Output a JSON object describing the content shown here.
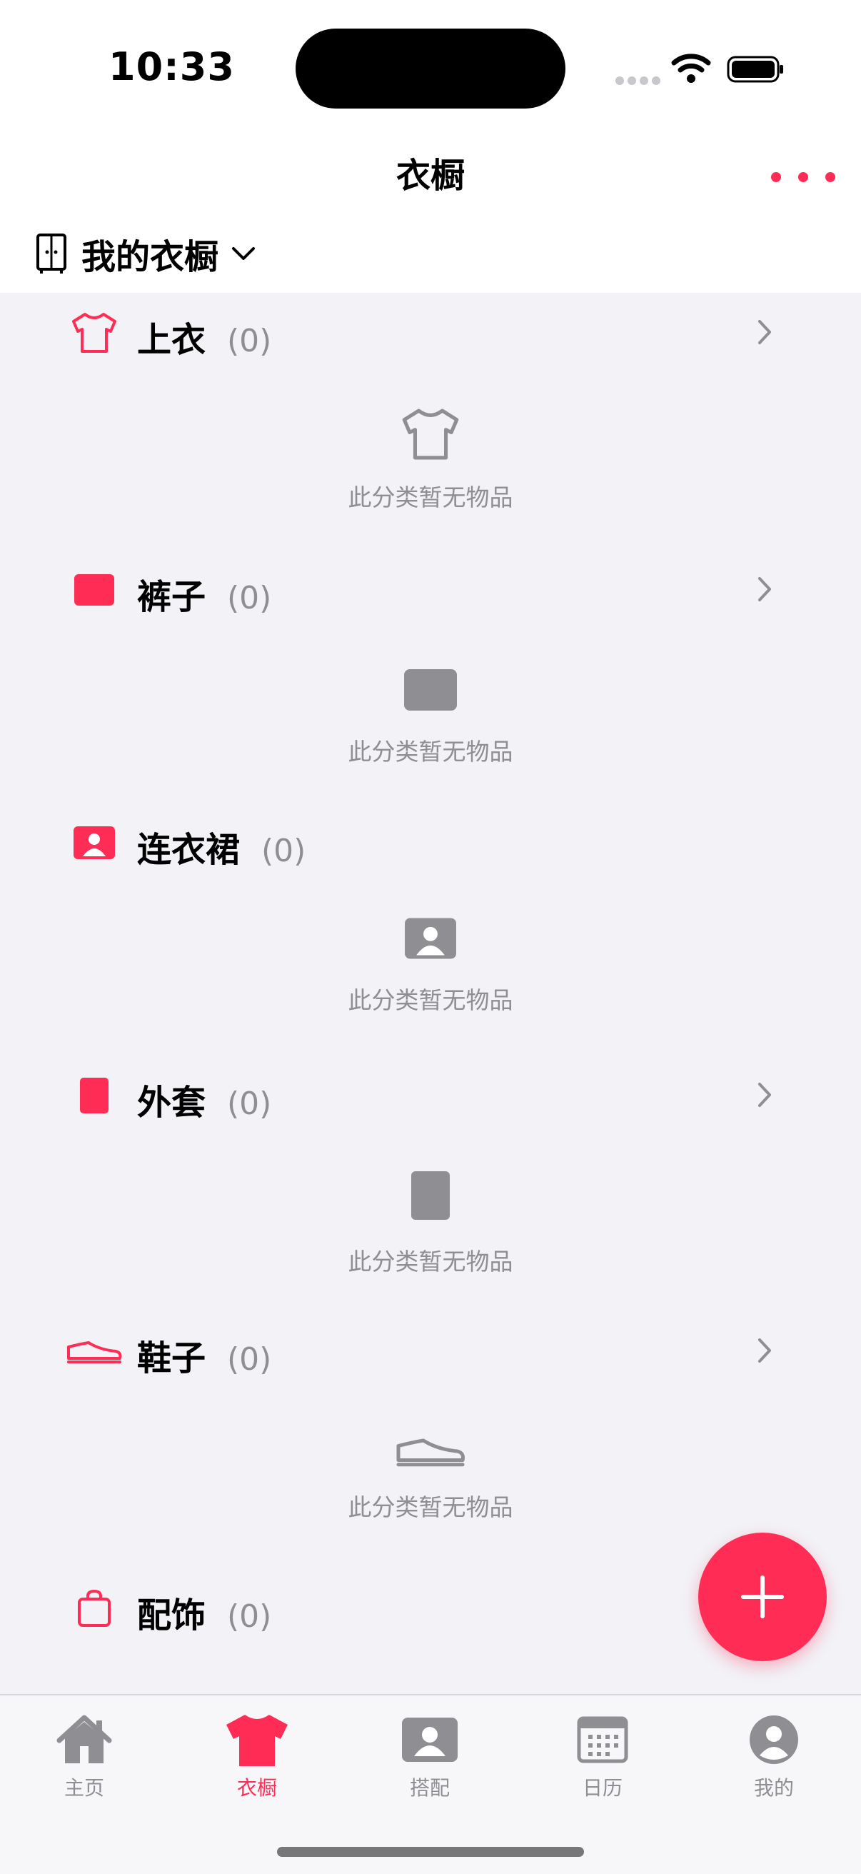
{
  "status": {
    "time": "10:33"
  },
  "nav": {
    "title": "衣橱"
  },
  "wardrobe": {
    "label": "我的衣橱"
  },
  "empty_text": "此分类暂无物品",
  "categories": [
    {
      "name": "上衣",
      "count": "(0)",
      "icon": "tshirt-icon"
    },
    {
      "name": "裤子",
      "count": "(0)",
      "icon": "pants-icon"
    },
    {
      "name": "连衣裙",
      "count": "(0)",
      "icon": "dress-icon"
    },
    {
      "name": "外套",
      "count": "(0)",
      "icon": "coat-icon"
    },
    {
      "name": "鞋子",
      "count": "(0)",
      "icon": "shoe-icon"
    },
    {
      "name": "配饰",
      "count": "(0)",
      "icon": "bag-icon"
    }
  ],
  "tabs": [
    {
      "label": "主页",
      "icon": "home-icon",
      "active": false
    },
    {
      "label": "衣橱",
      "icon": "tshirt-icon",
      "active": true
    },
    {
      "label": "搭配",
      "icon": "person-card-icon",
      "active": false
    },
    {
      "label": "日历",
      "icon": "calendar-icon",
      "active": false
    },
    {
      "label": "我的",
      "icon": "profile-icon",
      "active": false
    }
  ],
  "colors": {
    "accent": "#ff2d55",
    "muted": "#8e8e93",
    "background": "#f2f2f7"
  }
}
